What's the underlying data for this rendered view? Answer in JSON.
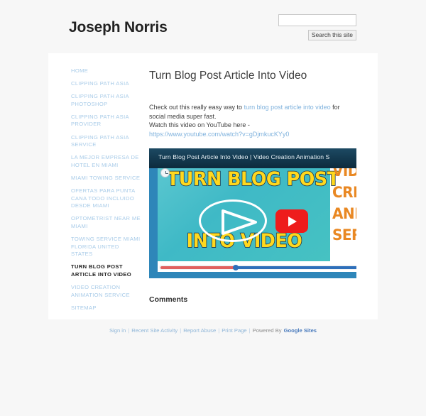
{
  "header": {
    "site_title": "Joseph Norris",
    "search": {
      "value": "",
      "placeholder": "",
      "button_label": "Search this site"
    }
  },
  "sidebar": {
    "items": [
      {
        "label": "HOME",
        "active": false
      },
      {
        "label": "CLIPPING PATH ASIA",
        "active": false
      },
      {
        "label": "CLIPPING PATH ASIA PHOTOSHOP",
        "active": false
      },
      {
        "label": "CLIPPING PATH ASIA PROVIDER",
        "active": false
      },
      {
        "label": "CLIPPING PATH ASIA SERVICE",
        "active": false
      },
      {
        "label": "LA MEJOR EMPRESA DE HOTEL EN MIAMI",
        "active": false
      },
      {
        "label": "MIAMI TOWING SERVICE",
        "active": false
      },
      {
        "label": "OFERTAS PARA PUNTA CANA TODO INCLUIDO DESDE MIAMI",
        "active": false
      },
      {
        "label": "OPTOMETRIST NEAR ME MIAMI",
        "active": false
      },
      {
        "label": "TOWING SERVICE MIAMI FLORIDA UNITED STATES",
        "active": false
      },
      {
        "label": "TURN BLOG POST ARTICLE INTO VIDEO",
        "active": true
      },
      {
        "label": "VIDEO CREATION ANIMATION SERVICE",
        "active": false
      },
      {
        "label": "SITEMAP",
        "active": false
      }
    ]
  },
  "main": {
    "page_title": "Turn Blog Post Article Into Video",
    "paragraph": {
      "line1_pre": "Check out this really easy way to ",
      "line1_link": "turn blog post article into video",
      "line1_post": " for social media super fast.",
      "line2_pre": "Watch this video on YouTube here - ",
      "line2_link": "https://www.youtube.com/watch?v=gDjmkucKYy0"
    },
    "video": {
      "title": "Turn Blog Post Article Into Video | Video Creation Animation S",
      "watch_later_icon": "clock-icon",
      "thumbnail": {
        "headline_top": "TURN BLOG POST",
        "headline_bottom": "INTO VIDEO",
        "side_text_lines": [
          "VIDEO",
          "CREATION",
          "ANIMATION",
          "SERVICE"
        ],
        "play_icon": "play-triangle-icon",
        "youtube_icon": "youtube-play-icon"
      },
      "progress": {
        "played_percent": 31,
        "loaded_percent": 100
      }
    },
    "comments_heading": "Comments"
  },
  "footer": {
    "links": [
      "Sign in",
      "Recent Site Activity",
      "Report Abuse",
      "Print Page"
    ],
    "separator": "|",
    "powered_by_label": "Powered By",
    "brand": "Google Sites"
  },
  "colors": {
    "page_background": "#f7f7f7",
    "card_background": "#ffffff",
    "nav_link": "#a8cbe8",
    "nav_active": "#222222",
    "body_text": "#3f3f3f",
    "link": "#7fb2dd",
    "thumb_teal": "#46c2c2",
    "thumb_yellow": "#ffd81e",
    "thumb_orange": "#e98823",
    "youtube_red": "#ee1c1c",
    "player_bar": "#13384e",
    "progress_played": "#e0605f",
    "progress_loaded": "#2e6fba",
    "frame_blue": "#2e86b9",
    "brand_blue": "#4a7bbd"
  }
}
